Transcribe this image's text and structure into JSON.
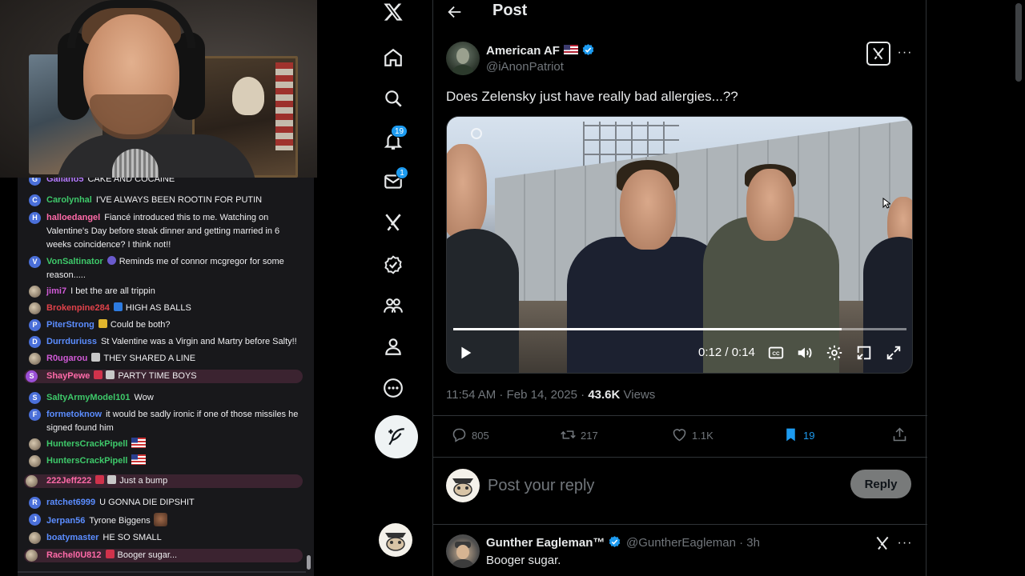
{
  "stream": {
    "chat": [
      {
        "user": "Galiano5",
        "color": "#b57bff",
        "badges": [],
        "text": "CAKE AND COCAINE",
        "avatar": "G",
        "avatar_color": "#4a6fd9"
      },
      {
        "user": "Carolynhal",
        "color": "#3ec96a",
        "badges": [],
        "text": "I'VE ALWAYS BEEN ROOTIN FOR PUTIN",
        "avatar": "C",
        "avatar_color": "#4a6fd9"
      },
      {
        "user": "halloedangel",
        "color": "#ff6aa8",
        "badges": [],
        "text": "Fiancé introduced this to me. Watching on Valentine's Day before steak dinner and getting married in 6 weeks coincidence? I think not!!",
        "avatar": "H",
        "avatar_color": "#4a6fd9"
      },
      {
        "user": "VonSaltinator",
        "color": "#3ec96a",
        "badges": [
          "sub"
        ],
        "text": "Reminds me of connor mcgregor for some reason.....",
        "avatar": "V",
        "avatar_color": "#4a6fd9"
      },
      {
        "user": "jimi7",
        "color": "#d05ad6",
        "badges": [],
        "text": "I bet the are all trippin",
        "avatar": "",
        "avatar_color": "#cfcfcf"
      },
      {
        "user": "Brokenpine284",
        "color": "#e0424a",
        "badges": [
          "blue"
        ],
        "text": "HIGH AS BALLS",
        "avatar": "",
        "avatar_color": "#6b5b4b"
      },
      {
        "user": "PiterStrong",
        "color": "#5b8dff",
        "badges": [
          "yellow"
        ],
        "text": "Could be both?",
        "avatar": "P",
        "avatar_color": "#4a6fd9"
      },
      {
        "user": "Durrduriuss",
        "color": "#5b8dff",
        "badges": [],
        "text": "St Valentine was a Virgin and Martry before Salty!!",
        "avatar": "D",
        "avatar_color": "#4a6fd9"
      },
      {
        "user": "R0ugarou",
        "color": "#d05ad6",
        "badges": [
          "grey"
        ],
        "text": "THEY SHARED A LINE",
        "avatar": "",
        "avatar_color": "#6b5b4b"
      },
      {
        "user": "ShayPewe",
        "color": "#ff6aa8",
        "badges": [
          "red",
          "grey"
        ],
        "text": "PARTY TIME BOYS",
        "avatar": "S",
        "avatar_color": "#9b4fd6",
        "highlight": true
      },
      {
        "user": "SaltyArmyModel101",
        "color": "#3ec96a",
        "badges": [],
        "text": "Wow",
        "avatar": "S",
        "avatar_color": "#4a6fd9"
      },
      {
        "user": "formetoknow",
        "color": "#5b8dff",
        "badges": [],
        "text": "it would be sadly ironic if one of those missiles he signed found him",
        "avatar": "F",
        "avatar_color": "#4a6fd9"
      },
      {
        "user": "HuntersCrackPipell",
        "color": "#3ec96a",
        "badges": [],
        "text": "",
        "emote": "flag",
        "avatar": "",
        "avatar_color": "#6b5b4b"
      },
      {
        "user": "HuntersCrackPipell",
        "color": "#3ec96a",
        "badges": [],
        "text": "",
        "emote": "flag",
        "avatar": "",
        "avatar_color": "#6b5b4b"
      },
      {
        "user": "222Jeff222",
        "color": "#ff6aa8",
        "badges": [
          "red",
          "grey"
        ],
        "text": "Just a bump",
        "avatar": "",
        "avatar_color": "#6b5b4b",
        "highlight": true
      },
      {
        "user": "ratchet6999",
        "color": "#5b8dff",
        "badges": [],
        "text": "U GONNA DIE DIPSHIT",
        "avatar": "R",
        "avatar_color": "#4a6fd9"
      },
      {
        "user": "Jerpan56",
        "color": "#5b8dff",
        "badges": [],
        "text": "Tyrone Biggens",
        "emote": "face",
        "avatar": "J",
        "avatar_color": "#4a6fd9"
      },
      {
        "user": "boatymaster",
        "color": "#5b8dff",
        "badges": [],
        "text": "HE SO SMALL",
        "avatar": "",
        "avatar_color": "#e8e4da"
      },
      {
        "user": "Rachel0U812",
        "color": "#ff6aa8",
        "badges": [
          "red"
        ],
        "text": "Booger sugar...",
        "avatar": "",
        "avatar_color": "#6b5b4b",
        "highlight": true
      }
    ]
  },
  "x": {
    "nav": {
      "items": [
        "x-logo",
        "home",
        "search",
        "notifications",
        "messages",
        "grok",
        "verified",
        "communities",
        "profile",
        "more"
      ],
      "notifications_badge": "19",
      "messages_badge": "1"
    },
    "header": {
      "title": "Post"
    },
    "post": {
      "author_name": "American AF",
      "author_handle": "@iAnonPatriot",
      "text": "Does Zelensky just have really bad allergies...??",
      "video": {
        "time": "0:12 / 0:14",
        "progress": 0.857
      },
      "meta_time": "11:54 AM · Feb 14, 2025 · ",
      "views_count": "43.6K",
      "views_label": " Views",
      "replies": "805",
      "reposts": "217",
      "likes": "1.1K",
      "bookmarks": "19"
    },
    "reply_box": {
      "placeholder": "Post your reply",
      "button": "Reply"
    },
    "comment": {
      "name": "Gunther Eagleman™",
      "handle": "@GuntherEagleman · 3h",
      "text": "Booger sugar."
    },
    "colors": {
      "accent": "#1d9bf0",
      "text": "#e7e9ea",
      "muted": "#71767b",
      "border": "#2f3336"
    }
  }
}
